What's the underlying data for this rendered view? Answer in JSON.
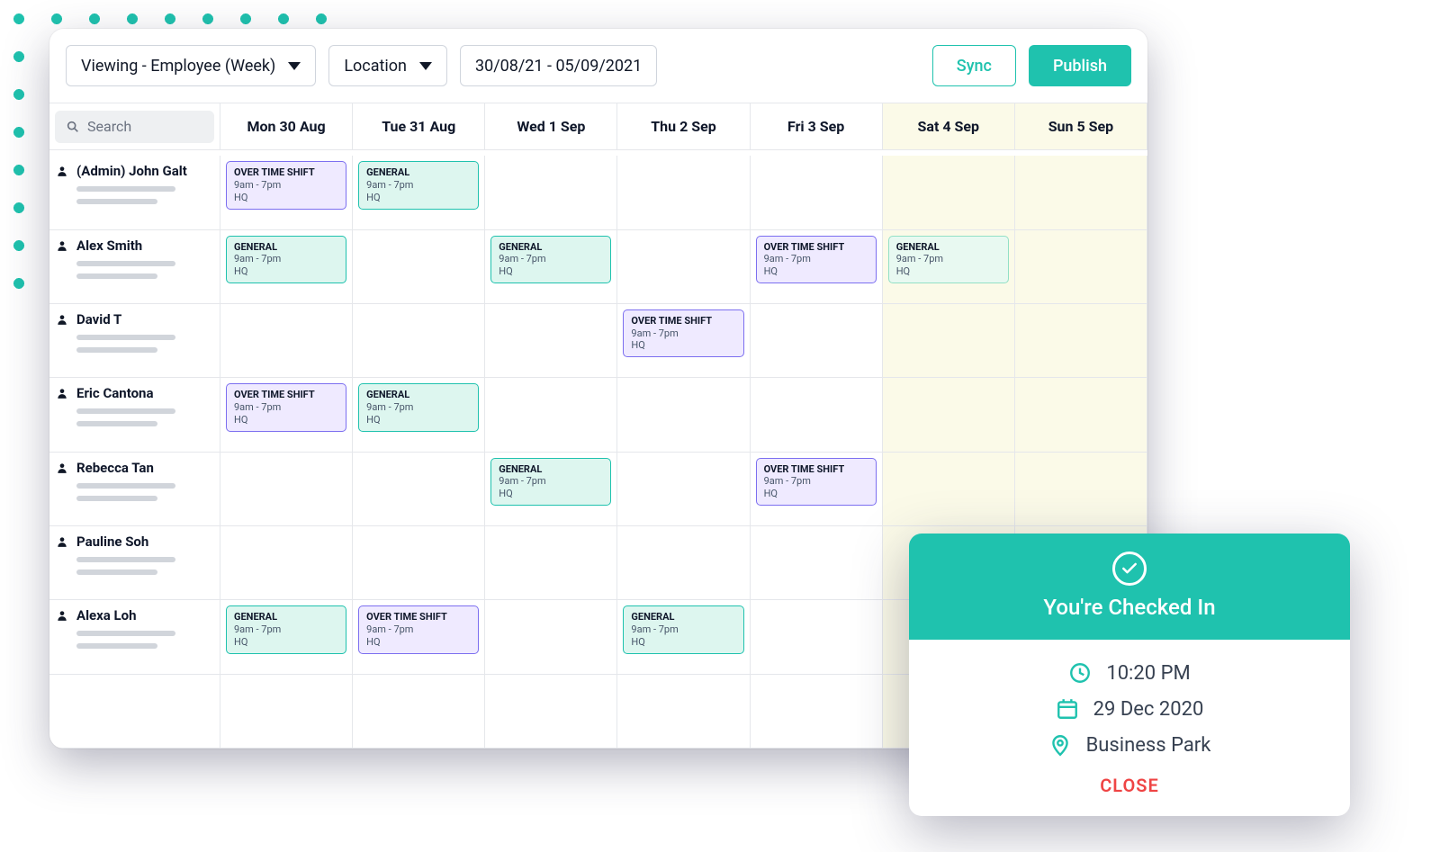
{
  "toolbar": {
    "view_mode": "Viewing - Employee (Week)",
    "location_label": "Location",
    "date_range": "30/08/21 - 05/09/2021",
    "sync_label": "Sync",
    "publish_label": "Publish"
  },
  "search": {
    "placeholder": "Search"
  },
  "days": [
    "Mon 30 Aug",
    "Tue 31 Aug",
    "Wed 1 Sep",
    "Thu 2 Sep",
    "Fri 3 Sep",
    "Sat 4 Sep",
    "Sun 5 Sep"
  ],
  "weekend_cols": [
    5,
    6
  ],
  "shift_styles": {
    "general": {
      "color": "#1fc2ae",
      "bg": "#ddf6ef"
    },
    "general_light": {
      "color": "#92e0c6",
      "bg": "#e8f9f1"
    },
    "overtime": {
      "color": "#7c6ff0",
      "bg": "#efeaff"
    }
  },
  "employees": [
    {
      "name": "(Admin) John Galt",
      "shifts": [
        {
          "day": 0,
          "type": "overtime",
          "title": "OVER TIME SHIFT",
          "time": "9am - 7pm",
          "loc": "HQ"
        },
        {
          "day": 1,
          "type": "general",
          "title": "GENERAL",
          "time": "9am - 7pm",
          "loc": "HQ"
        }
      ]
    },
    {
      "name": "Alex Smith",
      "shifts": [
        {
          "day": 0,
          "type": "general",
          "title": "GENERAL",
          "time": "9am - 7pm",
          "loc": "HQ"
        },
        {
          "day": 2,
          "type": "general",
          "title": "GENERAL",
          "time": "9am - 7pm",
          "loc": "HQ"
        },
        {
          "day": 4,
          "type": "overtime",
          "title": "OVER TIME SHIFT",
          "time": "9am - 7pm",
          "loc": "HQ"
        },
        {
          "day": 5,
          "type": "general_light",
          "title": "GENERAL",
          "time": "9am - 7pm",
          "loc": "HQ"
        }
      ]
    },
    {
      "name": "David T",
      "shifts": [
        {
          "day": 3,
          "type": "overtime",
          "title": "OVER TIME SHIFT",
          "time": "9am - 7pm",
          "loc": "HQ"
        }
      ]
    },
    {
      "name": "Eric Cantona",
      "shifts": [
        {
          "day": 0,
          "type": "overtime",
          "title": "OVER TIME SHIFT",
          "time": "9am - 7pm",
          "loc": "HQ"
        },
        {
          "day": 1,
          "type": "general",
          "title": "GENERAL",
          "time": "9am - 7pm",
          "loc": "HQ"
        }
      ]
    },
    {
      "name": "Rebecca Tan",
      "shifts": [
        {
          "day": 2,
          "type": "general",
          "title": "GENERAL",
          "time": "9am - 7pm",
          "loc": "HQ"
        },
        {
          "day": 4,
          "type": "overtime",
          "title": "OVER TIME SHIFT",
          "time": "9am - 7pm",
          "loc": "HQ"
        }
      ]
    },
    {
      "name": "Pauline Soh",
      "shifts": []
    },
    {
      "name": "Alexa Loh",
      "shifts": [
        {
          "day": 0,
          "type": "general",
          "title": "GENERAL",
          "time": "9am - 7pm",
          "loc": "HQ"
        },
        {
          "day": 1,
          "type": "overtime",
          "title": "OVER TIME SHIFT",
          "time": "9am - 7pm",
          "loc": "HQ"
        },
        {
          "day": 3,
          "type": "general",
          "title": "GENERAL",
          "time": "9am - 7pm",
          "loc": "HQ"
        }
      ]
    },
    {
      "name": "",
      "shifts": []
    }
  ],
  "popup": {
    "heading": "You're Checked In",
    "time": "10:20 PM",
    "date": "29 Dec 2020",
    "location": "Business Park",
    "close_label": "CLOSE"
  }
}
